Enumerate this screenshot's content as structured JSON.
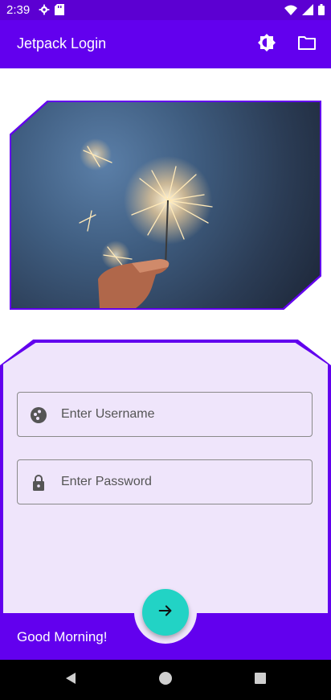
{
  "status_bar": {
    "time": "2:39",
    "icons": [
      "settings-icon",
      "sd-card-icon",
      "wifi-icon",
      "signal-icon",
      "battery-icon"
    ]
  },
  "app_bar": {
    "title": "Jetpack Login",
    "actions": [
      "brightness-icon",
      "folder-icon"
    ]
  },
  "hero": {
    "image": "sparkler-photo"
  },
  "form": {
    "username_placeholder": "Enter Username",
    "password_placeholder": "Enter Password"
  },
  "bottom_bar": {
    "greeting": "Good Morning!",
    "fab_icon": "arrow-right-icon"
  },
  "nav_bar": {
    "buttons": [
      "back-icon",
      "home-icon",
      "recents-icon"
    ]
  },
  "colors": {
    "primary": "#6200ee",
    "status_bar": "#5c00d2",
    "surface": "#efe5fb",
    "fab": "#22d3c5"
  }
}
